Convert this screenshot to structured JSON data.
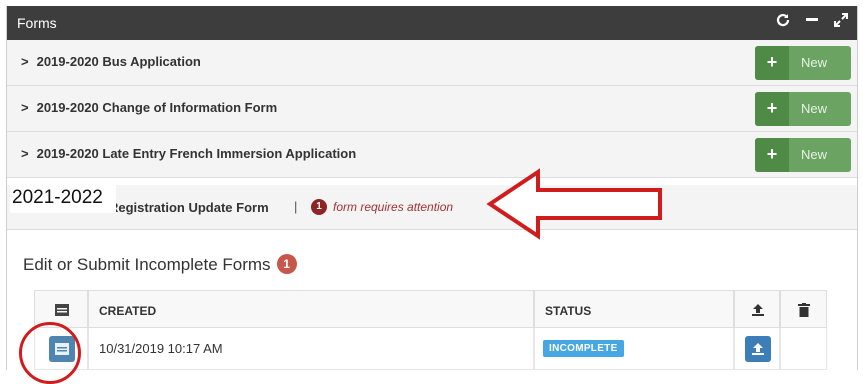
{
  "header": {
    "title": "Forms",
    "icons": [
      "refresh-icon",
      "minimize-icon",
      "expand-icon"
    ]
  },
  "forms": [
    {
      "label": "2019-2020 Bus Application",
      "new_label": "New"
    },
    {
      "label": "2019-2020 Change of Information Form",
      "new_label": "New"
    },
    {
      "label": "2019-2020 Late Entry French Immersion Application",
      "new_label": "New"
    }
  ],
  "registration": {
    "year_overlay": "2021-2022",
    "label": "Registration Update Form",
    "separator": "|",
    "attention_count": "1",
    "attention_text": "form requires attention"
  },
  "incomplete": {
    "title": "Edit or Submit Incomplete Forms",
    "count": "1",
    "columns": {
      "created": "CREATED",
      "status": "STATUS"
    },
    "rows": [
      {
        "created": "10/31/2019 10:17 AM",
        "status": "INCOMPLETE"
      }
    ]
  },
  "colors": {
    "header_bg": "#3d3d3d",
    "new_button": "#6aa362",
    "attention": "#8f2424",
    "status_badge": "#46a7e2",
    "annotation_red": "#d01c1c"
  }
}
